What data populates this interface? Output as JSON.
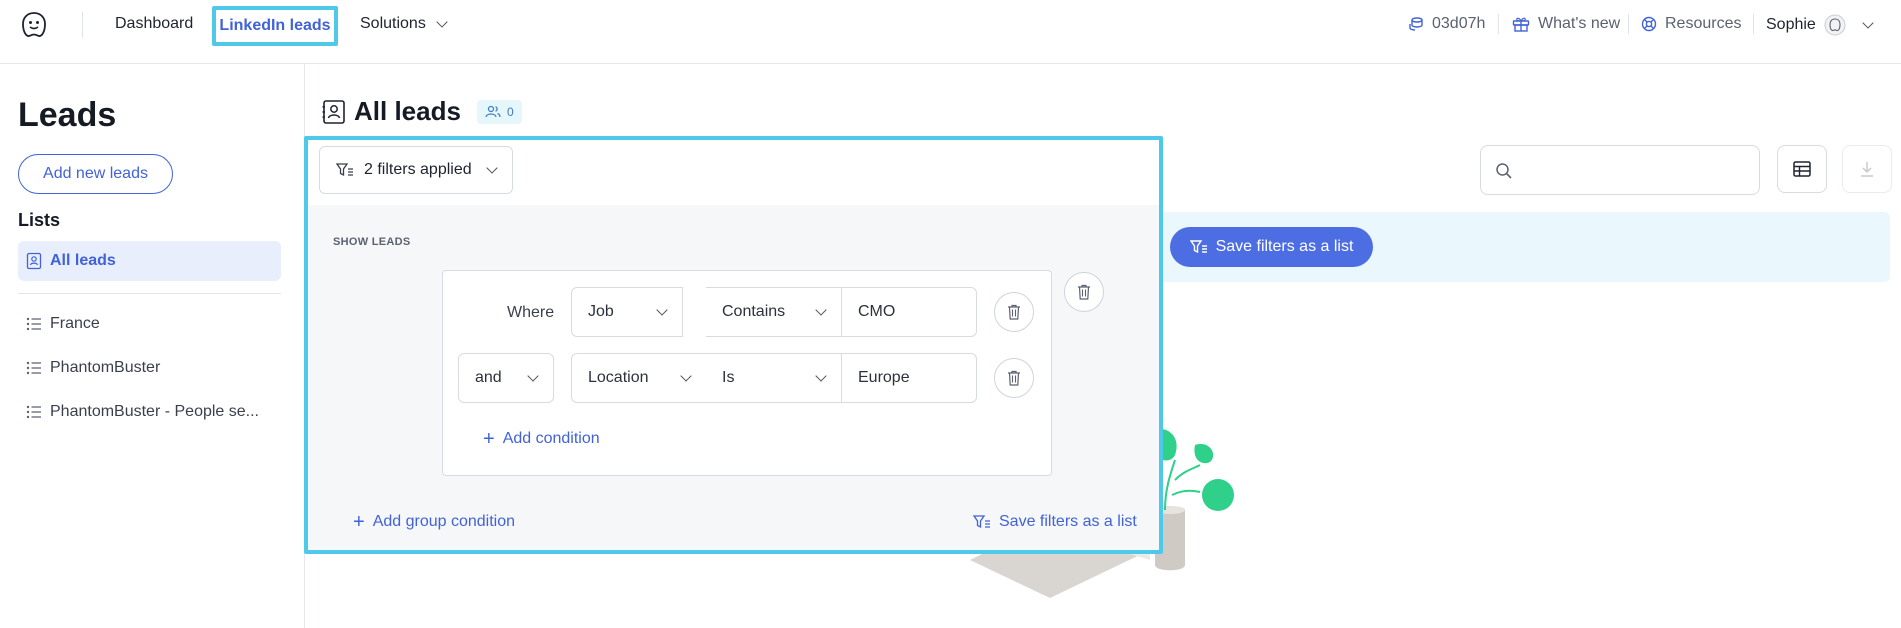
{
  "topbar": {
    "nav": {
      "dashboard": "Dashboard",
      "linkedin_leads": "LinkedIn leads",
      "solutions": "Solutions"
    },
    "time_credit": "03d07h",
    "whats_new": "What's new",
    "resources": "Resources",
    "user_name": "Sophie"
  },
  "sidebar": {
    "title": "Leads",
    "add_button": "Add new leads",
    "lists_title": "Lists",
    "active_item": "All leads",
    "items": [
      {
        "label": "France"
      },
      {
        "label": "PhantomBuster"
      },
      {
        "label": "PhantomBuster - People se..."
      }
    ]
  },
  "main": {
    "title": "All leads",
    "lead_count": "0",
    "save_filters_button": "Save filters as a list"
  },
  "filter_panel": {
    "filters_button": "2 filters applied",
    "section_label": "SHOW LEADS",
    "conditions": [
      {
        "connector": "Where",
        "field": "Job",
        "operator": "Contains",
        "value": "CMO"
      },
      {
        "connector": "and",
        "field": "Location",
        "operator": "Is",
        "value": "Europe"
      }
    ],
    "add_condition": "Add condition",
    "add_group_condition": "Add group condition",
    "save_filters": "Save filters as a list"
  },
  "colors": {
    "accent": "#4162d8",
    "highlight_border": "#4fc9ea",
    "active_bg": "#e9eefc",
    "banner_bg": "#eaf7fc",
    "save_button_bg": "#4d6ee3",
    "illustration_green": "#2fd08a"
  },
  "icons": [
    "ghost-logo-icon",
    "coins-icon",
    "gift-icon",
    "lifebuoy-icon",
    "avatar-icon",
    "contact-card-icon",
    "list-icon",
    "people-icon",
    "search-icon",
    "table-icon",
    "download-icon",
    "filter-list-icon",
    "trash-icon",
    "plus-icon",
    "chevron-down-icon"
  ]
}
